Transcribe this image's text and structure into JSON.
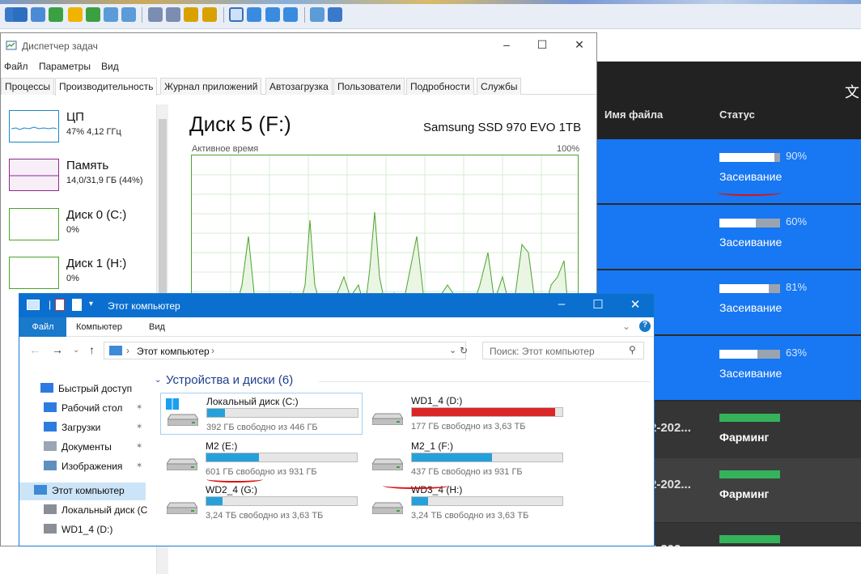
{
  "taskmgr": {
    "title": "Диспетчер задач",
    "menu": [
      "Файл",
      "Параметры",
      "Вид"
    ],
    "tabs": [
      "Процессы",
      "Производительность",
      "Журнал приложений",
      "Автозагрузка",
      "Пользователи",
      "Подробности",
      "Службы"
    ],
    "active_tab": "Производительность",
    "resources": [
      {
        "name": "ЦП",
        "value": "47% 4,12 ГГц",
        "color": "#1a86c8"
      },
      {
        "name": "Память",
        "value": "14,0/31,9 ГБ (44%)",
        "color": "#8e2a8e"
      },
      {
        "name": "Диск 0 (C:)",
        "value": "0%",
        "color": "#4da32a"
      },
      {
        "name": "Диск 1 (H:)",
        "value": "0%",
        "color": "#4da32a"
      }
    ],
    "detail": {
      "title": "Диск 5 (F:)",
      "model": "Samsung SSD 970 EVO 1TB",
      "graph_label": "Активное время",
      "graph_max": "100%"
    }
  },
  "explorer": {
    "title": "Этот компьютер",
    "ribbon": {
      "file": "Файл",
      "tabs": [
        "Компьютер",
        "Вид"
      ]
    },
    "address": "Этот компьютер",
    "search_placeholder": "Поиск: Этот компьютер",
    "nav": [
      {
        "label": "Быстрый доступ",
        "icon": "star-icon",
        "pinned": false
      },
      {
        "label": "Рабочий стол",
        "icon": "desktop-icon",
        "pinned": true
      },
      {
        "label": "Загрузки",
        "icon": "download-icon",
        "pinned": true
      },
      {
        "label": "Документы",
        "icon": "documents-icon",
        "pinned": true
      },
      {
        "label": "Изображения",
        "icon": "pictures-icon",
        "pinned": true
      },
      {
        "label": "Этот компьютер",
        "icon": "computer-icon",
        "pinned": false
      },
      {
        "label": "Локальный диск (C",
        "icon": "drive-icon",
        "pinned": false
      },
      {
        "label": "WD1_4 (D:)",
        "icon": "drive-icon",
        "pinned": false
      }
    ],
    "section_title": "Устройства и диски (6)",
    "drives": [
      {
        "name": "Локальный диск (C:)",
        "free": "392 ГБ свободно из 446 ГБ",
        "used_fraction": 0.12,
        "full": false
      },
      {
        "name": "WD1_4 (D:)",
        "free": "177 ГБ свободно из 3,63 ТБ",
        "used_fraction": 0.95,
        "full": true
      },
      {
        "name": "M2 (E:)",
        "free": "601 ГБ свободно из 931 ГБ",
        "used_fraction": 0.35,
        "full": false
      },
      {
        "name": "M2_1 (F:)",
        "free": "437 ГБ свободно из 931 ГБ",
        "used_fraction": 0.53,
        "full": false
      },
      {
        "name": "WD2_4 (G:)",
        "free": "3,24 ТБ свободно из 3,63 ТБ",
        "used_fraction": 0.11,
        "full": false
      },
      {
        "name": "WD3_4 (H:)",
        "free": "3,24 ТБ свободно из 3,63 ТБ",
        "used_fraction": 0.11,
        "full": false
      }
    ]
  },
  "dark_app": {
    "col_filename": "Имя файла",
    "col_status": "Статус",
    "rows": [
      {
        "progress": 0.9,
        "pct": "90%",
        "status": "Засеивание",
        "date": ""
      },
      {
        "progress": 0.6,
        "pct": "60%",
        "status": "Засеивание",
        "date": ""
      },
      {
        "progress": 0.81,
        "pct": "81%",
        "status": "Засеивание",
        "date": ""
      },
      {
        "progress": 0.63,
        "pct": "63%",
        "status": "Засеивание",
        "date": ""
      },
      {
        "progress": 1.0,
        "pct": "",
        "status": "Фарминг",
        "date": "2-202..."
      },
      {
        "progress": 1.0,
        "pct": "",
        "status": "Фарминг",
        "date": "2-202..."
      },
      {
        "progress": 1.0,
        "pct": "",
        "status": "",
        "date": "2-202..."
      }
    ]
  }
}
